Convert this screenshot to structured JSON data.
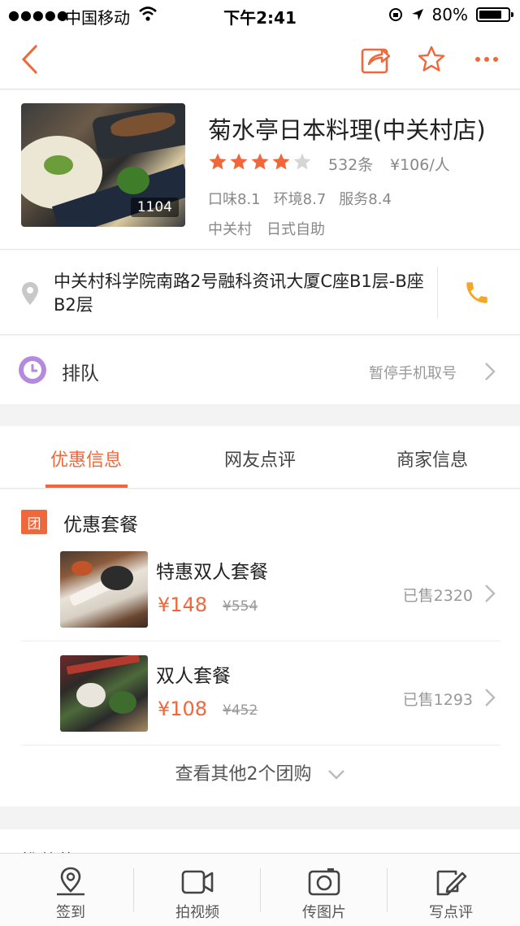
{
  "status_bar": {
    "signal": "●●●●●",
    "carrier": "中国移动",
    "time": "下午2:41",
    "battery": "80%",
    "battery_level": 0.8
  },
  "nav": {
    "back_icon": "chevron-left-icon",
    "share_icon": "share-icon",
    "favorite_icon": "star-outline-icon",
    "more_icon": "more-dots-icon",
    "accent": "#f0673c"
  },
  "shop": {
    "name": "菊水亭日本料理(中关村店)",
    "photo_count": "1104",
    "rating": 4,
    "rating_max": 5,
    "reviews": "532条",
    "price_per_person": "¥106/人",
    "scores": [
      "口味8.1",
      "环境8.7",
      "服务8.4"
    ],
    "tags": [
      "中关村",
      "日式自助"
    ]
  },
  "address": {
    "text": "中关村科学院南路2号融科资讯大厦C座B1层-B座B2层",
    "pin_icon": "location-pin-icon",
    "phone_icon": "phone-icon"
  },
  "queue": {
    "label": "排队",
    "status": "暂停手机取号",
    "icon": "clock-icon"
  },
  "tabs": [
    {
      "label": "优惠信息",
      "active": true
    },
    {
      "label": "网友点评",
      "active": false
    },
    {
      "label": "商家信息",
      "active": false
    }
  ],
  "deals": {
    "badge": "团",
    "title": "优惠套餐",
    "items": [
      {
        "name": "特惠双人套餐",
        "price": "¥148",
        "original_price": "¥554",
        "sold": "已售2320"
      },
      {
        "name": "双人套餐",
        "price": "¥108",
        "original_price": "¥452",
        "sold": "已售1293"
      }
    ],
    "more": "查看其他2个团购"
  },
  "peek_section": {
    "title": "推荐菜"
  },
  "tabbar": [
    {
      "label": "签到",
      "icon": "location-checkin-icon"
    },
    {
      "label": "拍视频",
      "icon": "video-camera-icon"
    },
    {
      "label": "传图片",
      "icon": "photo-camera-icon"
    },
    {
      "label": "写点评",
      "icon": "edit-review-icon"
    }
  ]
}
